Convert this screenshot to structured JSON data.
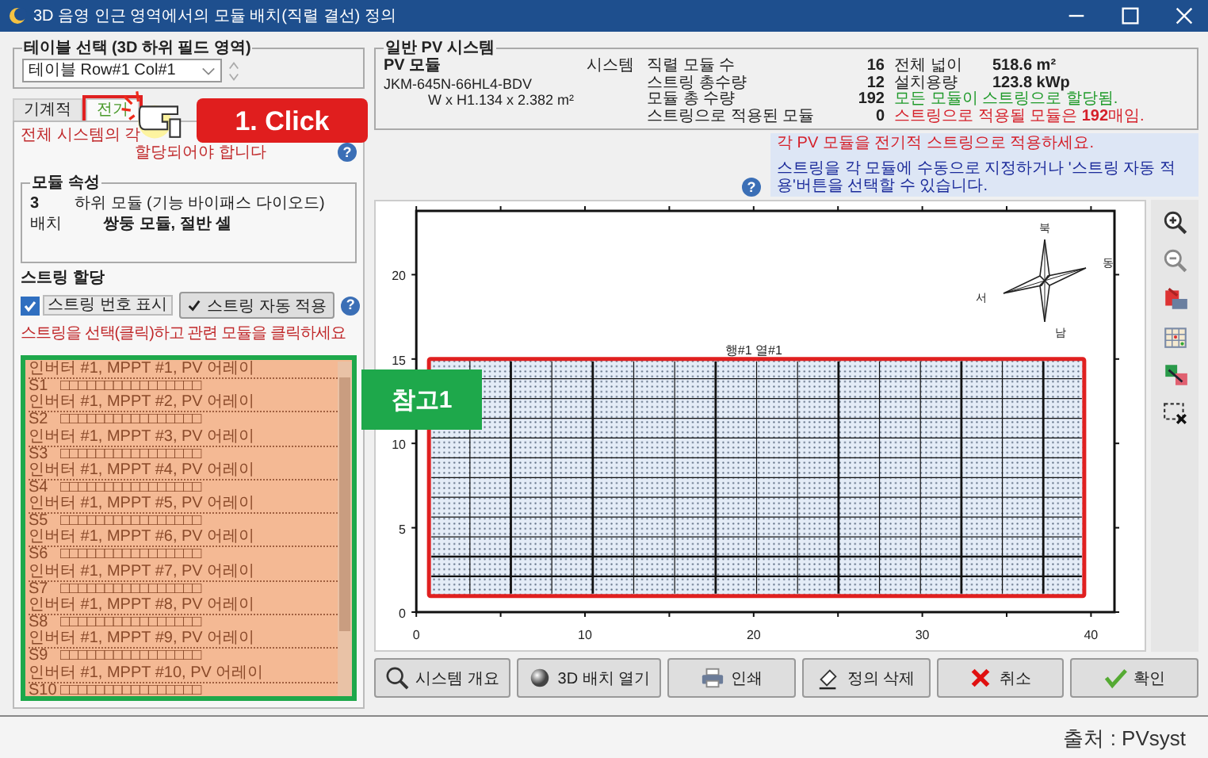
{
  "window": {
    "title": "3D 음영 인근 영역에서의 모듈 배치(직렬 결선) 정의"
  },
  "table_select": {
    "legend": "테이블 선택 (3D 하위 필드 영역)",
    "value": "테이블 Row#1 Col#1"
  },
  "tabs": [
    {
      "label": "기계적",
      "selected": false
    },
    {
      "label": "전기",
      "selected": true
    }
  ],
  "electrical": {
    "notice": [
      "전체 시스템의 각",
      "할당되어야 합니다"
    ],
    "help": "?",
    "module_attributes": {
      "legend": "모듈 속성",
      "rows": [
        {
          "label": "3",
          "value": "하위 모듈 (기능 바이패스 다이오드)"
        },
        {
          "label": "배치",
          "value": "쌍둥 모듈, 절반 셀"
        }
      ]
    },
    "string_title": "스트링 할당",
    "show_numbers": {
      "label": "스트링 번호 표시",
      "checked": true
    },
    "auto_button": "스트링 자동 적용",
    "auto_help": "?",
    "hint": "스트링을 선택(클릭)하고 관련 모듈을 클릭하세요"
  },
  "strings": [
    {
      "header": "인버터 #1, MPPT #1, PV 어레이",
      "name": "S1",
      "modules": "□□□□□□□□□□□□□□□□"
    },
    {
      "header": "인버터 #1, MPPT #2, PV 어레이",
      "name": "S2",
      "modules": "□□□□□□□□□□□□□□□□"
    },
    {
      "header": "인버터 #1, MPPT #3, PV 어레이",
      "name": "S3",
      "modules": "□□□□□□□□□□□□□□□□"
    },
    {
      "header": "인버터 #1, MPPT #4, PV 어레이",
      "name": "S4",
      "modules": "□□□□□□□□□□□□□□□□"
    },
    {
      "header": "인버터 #1, MPPT #5, PV 어레이",
      "name": "S5",
      "modules": "□□□□□□□□□□□□□□□□"
    },
    {
      "header": "인버터 #1, MPPT #6, PV 어레이",
      "name": "S6",
      "modules": "□□□□□□□□□□□□□□□□"
    },
    {
      "header": "인버터 #1, MPPT #7, PV 어레이",
      "name": "S7",
      "modules": "□□□□□□□□□□□□□□□□"
    },
    {
      "header": "인버터 #1, MPPT #8, PV 어레이",
      "name": "S8",
      "modules": "□□□□□□□□□□□□□□□□"
    },
    {
      "header": "인버터 #1, MPPT #9, PV 어레이",
      "name": "S9",
      "modules": "□□□□□□□□□□□□□□□□"
    },
    {
      "header": "인버터 #1, MPPT #10, PV 어레이",
      "name": "S10",
      "modules": "□□□□□□□□□□□□□□□□"
    }
  ],
  "pv_system": {
    "legend": "일반 PV 시스템",
    "module_title": "PV 모듈",
    "module_model": "JKM-645N-66HL4-BDV",
    "module_size": "W x H1.134 x 2.382 m²",
    "system_label": "시스템",
    "stats": [
      {
        "label": "직렬 모듈 수",
        "value": "16",
        "label2": "전체 넓이",
        "value2": "518.6 m²"
      },
      {
        "label": "스트링 총수량",
        "value": "12",
        "label2": "설치용량",
        "value2": "123.8 kWp"
      },
      {
        "label": "모듈 총 수량",
        "value": "192",
        "message": "모든 모듈이 스트링으로 할당됨.",
        "kind": "ok"
      },
      {
        "label": "스트링으로 적용된 모듈",
        "value": "0",
        "message": "스트링으로 적용될 모듈은 **192**매임.",
        "kind": "error"
      }
    ]
  },
  "info": {
    "help": "?",
    "lines": [
      {
        "text": "각 PV 모듈을 전기적 스트링으로 적용하세요.",
        "kind": "warning"
      },
      {
        "text": "스트링을 각 모듈에 수동으로 지정하거나 '스트링 자동 적용'버튼을 선택할 수 있습니다.",
        "kind": "info"
      }
    ]
  },
  "plot": {
    "label": "행#1 열#1",
    "compass": [
      "북",
      "동",
      "서",
      "남"
    ],
    "x_ticks": [
      "0",
      "10",
      "20",
      "30",
      "40"
    ],
    "y_ticks": [
      "20",
      "15",
      "10",
      "5",
      "0"
    ]
  },
  "toolbar": [
    {
      "kind": "zoom_in"
    },
    {
      "kind": "zoom_out"
    },
    {
      "kind": "export"
    },
    {
      "kind": "table"
    },
    {
      "kind": "swap"
    },
    {
      "kind": "clear"
    }
  ],
  "buttons": [
    {
      "label": "시스템 개요",
      "kind": "overview"
    },
    {
      "label": "3D 배치 열기",
      "kind": "open3d"
    },
    {
      "label": "인쇄",
      "kind": "print"
    },
    {
      "label": "정의 삭제",
      "kind": "erase"
    },
    {
      "label": "취소",
      "kind": "cancel"
    },
    {
      "label": "확인",
      "kind": "ok"
    }
  ],
  "annotations": {
    "click": "1. Click",
    "reference": "참고1"
  },
  "source": "출처 : PVsyst"
}
